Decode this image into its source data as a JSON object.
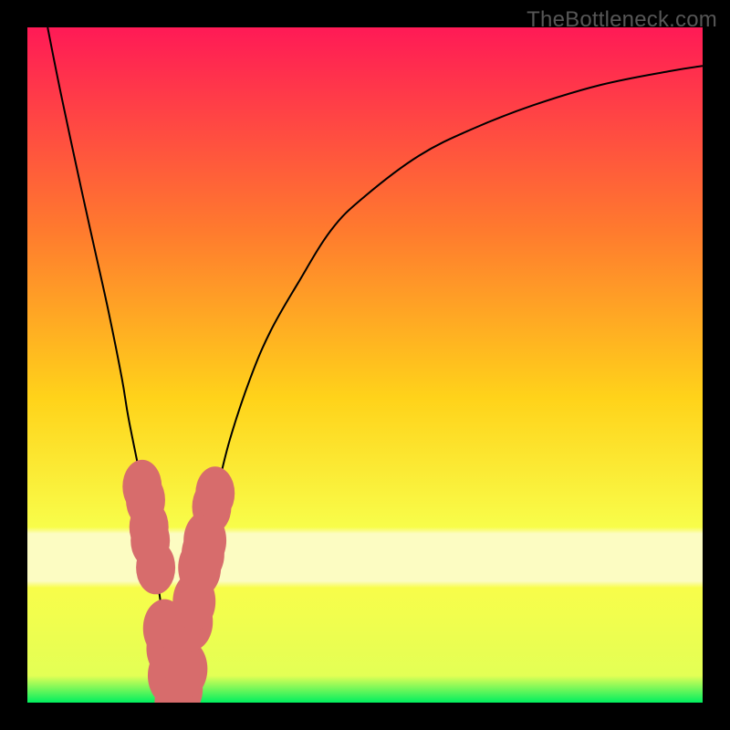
{
  "watermark": "TheBottleneck.com",
  "colors": {
    "frame": "#000000",
    "gradient_top": "#ff1a56",
    "gradient_mid_upper": "#ff7a2e",
    "gradient_mid": "#ffd31a",
    "gradient_mid_lower": "#f8fd4a",
    "gradient_band": "#fcfcc2",
    "gradient_bottom": "#00ef5f",
    "curve": "#000000",
    "marker_fill": "#d76c6c",
    "marker_stroke": "#a94a4a"
  },
  "chart_data": {
    "type": "line",
    "title": "",
    "xlabel": "",
    "ylabel": "",
    "xlim": [
      0,
      100
    ],
    "ylim": [
      0,
      100
    ],
    "x_at_min": 22,
    "series": [
      {
        "name": "bottleneck-curve",
        "x": [
          3,
          5,
          8,
          10,
          12,
          14,
          15,
          17,
          18,
          19,
          20,
          21,
          22,
          23,
          24,
          25,
          26,
          27,
          28,
          30,
          33,
          36,
          40,
          45,
          50,
          58,
          66,
          75,
          85,
          95,
          100
        ],
        "y": [
          100,
          90,
          76,
          67,
          58,
          48,
          42,
          32,
          26,
          20,
          13,
          7,
          0,
          5,
          11,
          17,
          22,
          27,
          31,
          39,
          48,
          55,
          62,
          70,
          75,
          81,
          85,
          88.5,
          91.5,
          93.5,
          94.3
        ]
      }
    ],
    "markers": [
      {
        "x": 17.0,
        "y": 32,
        "r": 2.2
      },
      {
        "x": 17.5,
        "y": 30,
        "r": 2.2
      },
      {
        "x": 18.0,
        "y": 26,
        "r": 2.2
      },
      {
        "x": 18.2,
        "y": 24,
        "r": 2.2
      },
      {
        "x": 19.0,
        "y": 20,
        "r": 2.2
      },
      {
        "x": 20.3,
        "y": 11,
        "r": 2.4
      },
      {
        "x": 20.8,
        "y": 8,
        "r": 2.4
      },
      {
        "x": 21.0,
        "y": 4,
        "r": 2.4
      },
      {
        "x": 22.0,
        "y": 0,
        "r": 2.4
      },
      {
        "x": 22.8,
        "y": 2,
        "r": 2.4
      },
      {
        "x": 23.5,
        "y": 5,
        "r": 2.4
      },
      {
        "x": 24.3,
        "y": 12,
        "r": 2.4
      },
      {
        "x": 24.7,
        "y": 15,
        "r": 2.4
      },
      {
        "x": 25.5,
        "y": 20,
        "r": 2.4
      },
      {
        "x": 26.0,
        "y": 22,
        "r": 2.4
      },
      {
        "x": 26.3,
        "y": 24,
        "r": 2.4
      },
      {
        "x": 27.3,
        "y": 29,
        "r": 2.2
      },
      {
        "x": 27.8,
        "y": 31,
        "r": 2.2
      }
    ]
  }
}
